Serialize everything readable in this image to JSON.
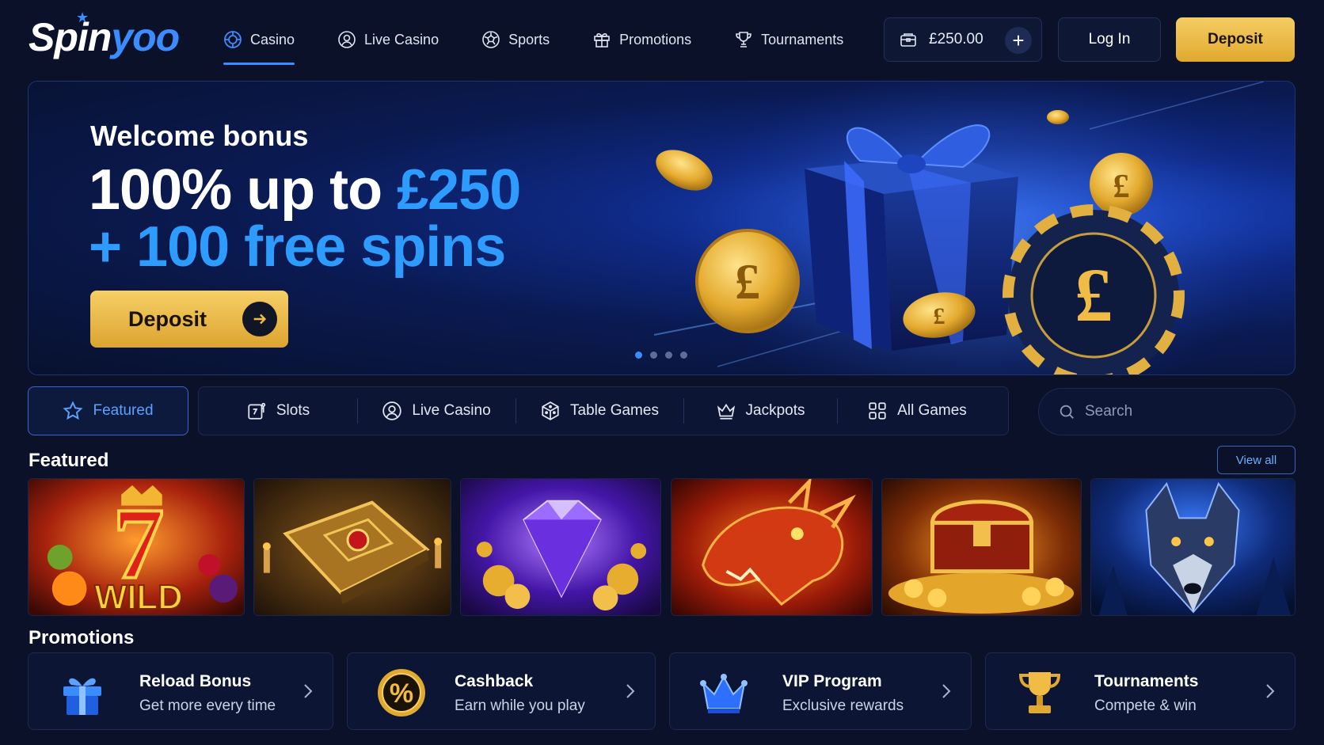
{
  "header": {
    "logo_main": "Spin",
    "logo_accent": "yoo",
    "nav": [
      {
        "label": "Casino",
        "icon": "casino-chip-icon",
        "active": true
      },
      {
        "label": "Live Casino",
        "icon": "live-casino-icon"
      },
      {
        "label": "Sports",
        "icon": "soccer-ball-icon"
      },
      {
        "label": "Promotions",
        "icon": "gift-icon"
      },
      {
        "label": "Tournaments",
        "icon": "trophy-icon"
      }
    ],
    "balance": "£250.00",
    "login_label": "Log In",
    "deposit_label": "Deposit"
  },
  "hero": {
    "subtitle": "Welcome bonus",
    "line1_main": "100% up to ",
    "line1_highlight": "£250",
    "line2": "+ 100 free spins",
    "button_label": "Deposit",
    "slides": 4,
    "active_slide": 1
  },
  "categories": {
    "featured_label": "Featured",
    "items": [
      {
        "label": "Slots",
        "icon": "slot-machine-icon"
      },
      {
        "label": "Live Casino",
        "icon": "live-casino-icon"
      },
      {
        "label": "Table Games",
        "icon": "dice-icon"
      },
      {
        "label": "Jackpots",
        "icon": "crown-icon"
      },
      {
        "label": "All Games",
        "icon": "grid-icon"
      }
    ],
    "search_placeholder": "Search"
  },
  "featured": {
    "title": "Featured",
    "view_all_label": "View all",
    "tile_word": "WILD"
  },
  "promotions": {
    "title": "Promotions",
    "items": [
      {
        "title": "Reload Bonus",
        "subtitle": "Get more every time",
        "icon": "gift-box-icon"
      },
      {
        "title": "Cashback",
        "subtitle": "Earn while you play",
        "icon": "percent-coin-icon"
      },
      {
        "title": "VIP Program",
        "subtitle": "Exclusive rewards",
        "icon": "crown-icon"
      },
      {
        "title": "Tournaments",
        "subtitle": "Compete & win",
        "icon": "trophy-icon"
      }
    ]
  },
  "colors": {
    "background": "#0a1128",
    "accent_blue": "#3b8cff",
    "gold": "#f0bc45"
  }
}
